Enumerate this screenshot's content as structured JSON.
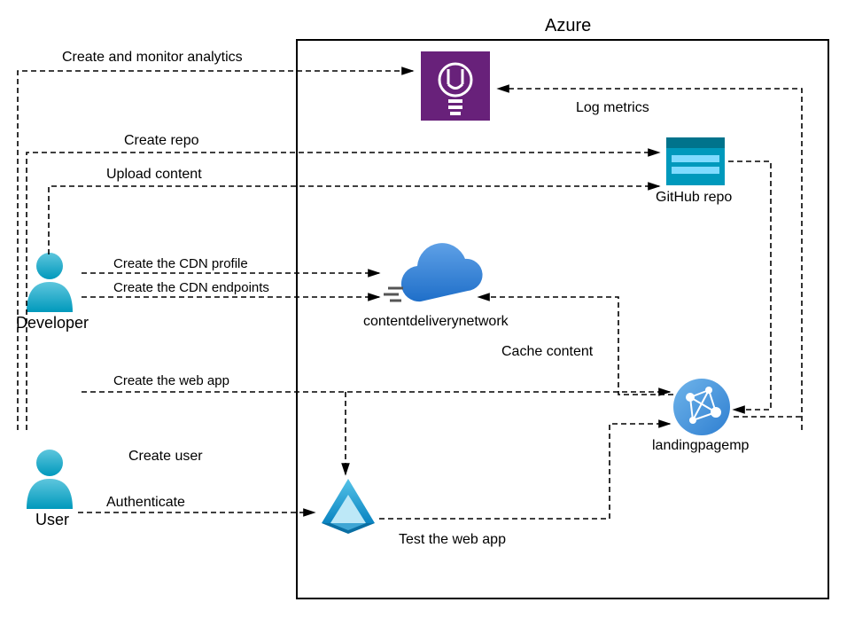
{
  "diagram": {
    "container_label": "Azure",
    "actors": {
      "developer": "Developer",
      "user": "User"
    },
    "nodes": {
      "insights": "",
      "githubrepo": "GitHub repo",
      "cdn": "contentdeliverynetwork",
      "webapp": "landingpagemp",
      "aad": ""
    },
    "edges": {
      "create_monitor_analytics": "Create and monitor analytics",
      "log_metrics": "Log metrics",
      "create_repo": "Create repo",
      "upload_content": "Upload content",
      "create_cdn_profile": "Create the CDN profile",
      "create_cdn_endpoints": "Create the CDN endpoints",
      "cache_content": "Cache content",
      "create_web_app": "Create the web app",
      "create_user": "Create user",
      "authenticate": "Authenticate",
      "test_web_app": "Test the web app"
    }
  }
}
